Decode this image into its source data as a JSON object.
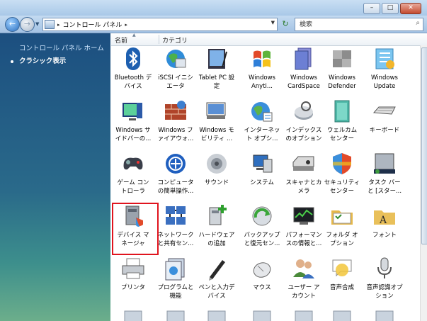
{
  "caption": {
    "minimize": "–",
    "maximize": "□",
    "close": "✕"
  },
  "nav": {
    "back": "←",
    "forward": "→",
    "dropdown": "▼",
    "crumbs": [
      {
        "label": "コントロール パネル"
      }
    ],
    "crumb_sep": "▸",
    "address_dropdown": "▼",
    "refresh": "↻",
    "search_placeholder": "検索",
    "search_icon": "⌕"
  },
  "left_pane": {
    "home_link": "コントロール パネル ホーム",
    "classic_view": "クラシック表示"
  },
  "columns": {
    "name": "名前",
    "category": "カテゴリ",
    "sort": "▲"
  },
  "items": [
    {
      "label": "Bluetooth デ\nバイス",
      "icon": "bluetooth-icon"
    },
    {
      "label": "iSCSI イニシ\nエータ",
      "icon": "globe-network-icon"
    },
    {
      "label": "Tablet PC 設\n定",
      "icon": "tablet-pc-icon"
    },
    {
      "label": "Windows\nAnyti...",
      "icon": "windows-flag-icon"
    },
    {
      "label": "Windows\nCardSpace",
      "icon": "cardspace-icon"
    },
    {
      "label": "Windows\nDefender",
      "icon": "defender-icon"
    },
    {
      "label": "Windows\nUpdate",
      "icon": "windows-update-icon"
    },
    {
      "label": "Windows サ\nイドバーの...",
      "icon": "sidebar-icon"
    },
    {
      "label": "Windows フ\nァイアウォ...",
      "icon": "firewall-icon"
    },
    {
      "label": "Windows モ\nビリティ ...",
      "icon": "mobility-icon"
    },
    {
      "label": "インターネッ\nト オプシ...",
      "icon": "internet-options-icon"
    },
    {
      "label": "インデックス\nのオプション",
      "icon": "indexing-icon"
    },
    {
      "label": "ウェルカム\nセンター",
      "icon": "welcome-center-icon"
    },
    {
      "label": "キーボード",
      "icon": "keyboard-icon"
    },
    {
      "label": "ゲーム コン\nトローラ",
      "icon": "game-controller-icon"
    },
    {
      "label": "コンピュータ\nの簡単操作...",
      "icon": "ease-of-access-icon"
    },
    {
      "label": "サウンド",
      "icon": "sound-icon"
    },
    {
      "label": "システム",
      "icon": "system-icon"
    },
    {
      "label": "スキャナとカ\nメラ",
      "icon": "scanner-camera-icon"
    },
    {
      "label": "セキュリティ\nセンター",
      "icon": "security-center-icon"
    },
    {
      "label": "タスク バー\nと [スター...",
      "icon": "taskbar-icon"
    },
    {
      "label": "デバイス マ\nネージャ",
      "icon": "device-manager-icon"
    },
    {
      "label": "ネットワーク\nと共有セン...",
      "icon": "network-sharing-icon"
    },
    {
      "label": "ハードウェア\nの追加",
      "icon": "add-hardware-icon"
    },
    {
      "label": "バックアップ\nと復元セン...",
      "icon": "backup-restore-icon"
    },
    {
      "label": "パフォーマン\nスの情報と...",
      "icon": "performance-icon"
    },
    {
      "label": "フォルダ オ\nプション",
      "icon": "folder-options-icon"
    },
    {
      "label": "フォント",
      "icon": "fonts-icon"
    },
    {
      "label": "プリンタ",
      "icon": "printer-icon"
    },
    {
      "label": "プログラムと\n機能",
      "icon": "programs-features-icon"
    },
    {
      "label": "ペンと入力デ\nバイス",
      "icon": "pen-input-icon"
    },
    {
      "label": "マウス",
      "icon": "mouse-icon"
    },
    {
      "label": "ユーザー ア\nカウント",
      "icon": "user-accounts-icon"
    },
    {
      "label": "音声合成",
      "icon": "speech-synthesis-icon"
    },
    {
      "label": "音声認識オプ\nション",
      "icon": "speech-recognition-icon"
    }
  ]
}
